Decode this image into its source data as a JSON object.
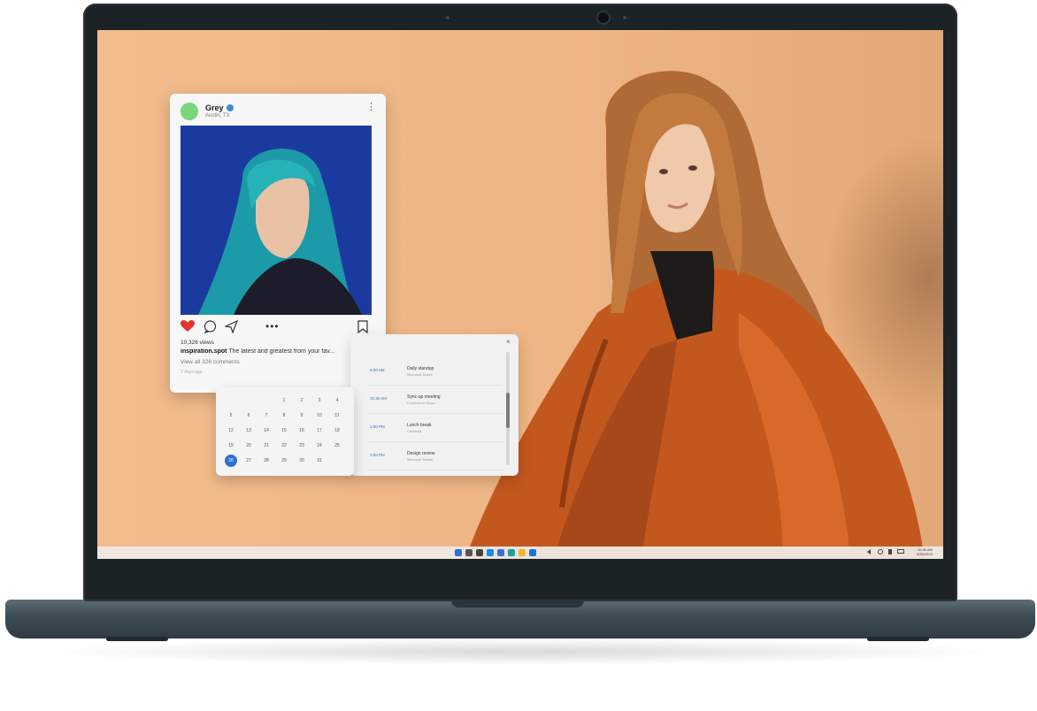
{
  "post": {
    "username": "Grey",
    "location": "Austin, TX",
    "views": "10,326 views",
    "caption_user": "inspiration.spot",
    "caption_text": "The latest and greatest from your fav...",
    "comments": "View all 326 comments",
    "date": "2 days ago",
    "icons": [
      "heart-icon",
      "comment-icon",
      "share-icon",
      "more-icon",
      "bookmark-icon"
    ]
  },
  "agenda": {
    "items": [
      {
        "time": "9:00 AM",
        "title": "Daily standup",
        "sub": "Microsoft Teams"
      },
      {
        "time": "10:30 AM",
        "title": "Sync-up meeting",
        "sub": "Conference Room"
      },
      {
        "time": "1:00 PM",
        "title": "Lunch break",
        "sub": "Cafeteria"
      },
      {
        "time": "3:00 PM",
        "title": "Design review",
        "sub": "Microsoft Teams"
      }
    ]
  },
  "calendar": {
    "days": [
      "1",
      "2",
      "3",
      "4",
      "5",
      "6",
      "7",
      "8",
      "9",
      "10",
      "11",
      "12",
      "13",
      "14",
      "15",
      "16",
      "17",
      "18",
      "19",
      "20",
      "21",
      "22",
      "23",
      "24",
      "25",
      "26",
      "27",
      "28",
      "29",
      "30",
      "31"
    ],
    "selected": "26"
  },
  "taskbar": {
    "icons": [
      "windows-start-icon",
      "search-icon",
      "task-view-icon",
      "widgets-icon",
      "store-icon",
      "edge-icon",
      "file-explorer-icon",
      "mail-icon"
    ],
    "colors": [
      "#2f6fd1",
      "#555555",
      "#444444",
      "#1e88e5",
      "#3d6fd6",
      "#1aa1a1",
      "#f2b530",
      "#1976d2"
    ],
    "time": "10:45 AM",
    "date": "6/26/2023"
  }
}
